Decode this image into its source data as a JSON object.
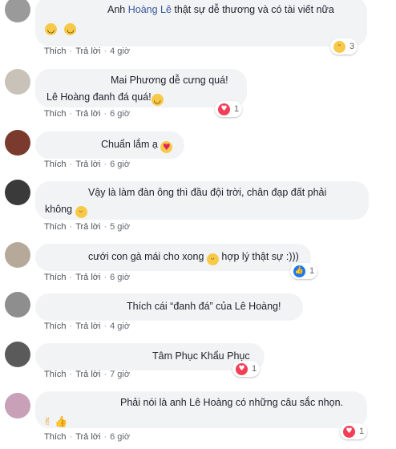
{
  "actions": {
    "like": "Thích",
    "reply": "Trả lời",
    "sep": "·"
  },
  "colors": {
    "bubble": "#f2f3f5",
    "name_link": "#385898",
    "love": "#f33e58",
    "like": "#1877f2",
    "haha": "#f7c948"
  },
  "comments": [
    {
      "text_before": "Anh ",
      "mention": "Hoàng Lê",
      "text_after": " thật sự dễ thương và có tài viết nữa",
      "emojis": [
        "smile",
        "smile"
      ],
      "time": "4 giờ",
      "reaction": {
        "icon": "haha-icon",
        "count": "3"
      }
    },
    {
      "line1": "Mai Phương dễ cưng quá!",
      "line2": "Lê Hoàng đanh đá quá!",
      "emojis": [
        "smile"
      ],
      "time": "6 giờ",
      "reaction": {
        "icon": "love-icon",
        "count": "1"
      }
    },
    {
      "line1": "Chuẩn lắm ạ",
      "emojis": [
        "heart-eyes"
      ],
      "time": "6 giờ"
    },
    {
      "line1": "Vậy là làm đàn ông thì đầu đội trời, chân đạp đất phải",
      "line2": "không",
      "emojis": [
        "tongue"
      ],
      "time": "5 giờ"
    },
    {
      "text_before": "cưới con gà mái cho xong ",
      "text_after": " hợp lý thật sự :)))",
      "emojis": [
        "tongue"
      ],
      "time": "6 giờ",
      "reaction": {
        "icon": "like-icon",
        "count": "1"
      }
    },
    {
      "line1": "Thích cái “đanh đá” của Lê Hoàng!",
      "time": "4 giờ"
    },
    {
      "line1": "Tâm Phục Khẩu Phục",
      "time": "7 giờ",
      "reaction": {
        "icon": "love-icon",
        "count": "1"
      }
    },
    {
      "line1": "Phải nói là anh Lê Hoàng có những câu sắc nhọn.",
      "emojis": [
        "ok-hand",
        "thumbs-up"
      ],
      "time": "6 giờ",
      "reaction": {
        "icon": "love-icon",
        "count": "1"
      }
    }
  ]
}
